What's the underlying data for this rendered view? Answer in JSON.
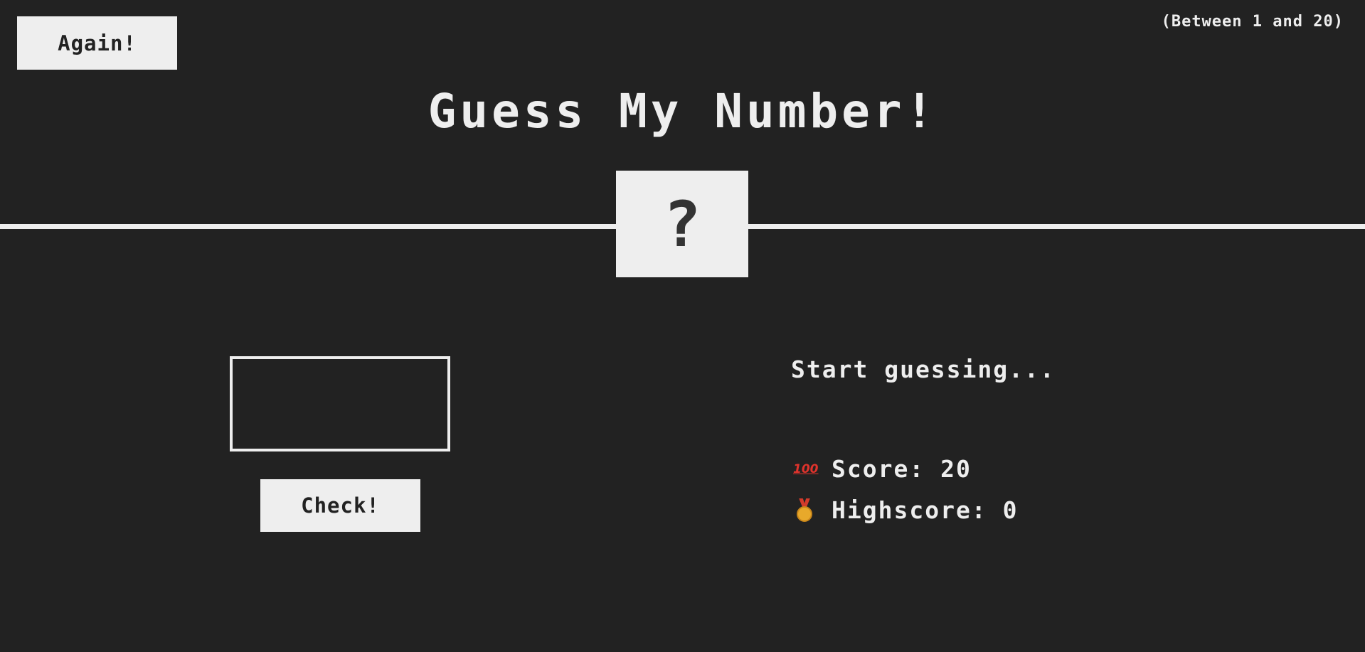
{
  "header": {
    "again_label": "Again!",
    "range_label": "(Between 1 and 20)",
    "title": "Guess My Number!"
  },
  "secret": {
    "display": "?"
  },
  "guess": {
    "value": "",
    "check_label": "Check!"
  },
  "status": {
    "message": "Start guessing...",
    "score_label": "Score:",
    "score_value": "20",
    "highscore_label": "Highscore:",
    "highscore_value": "0",
    "score_icon": "hundred-points-icon",
    "highscore_icon": "medal-icon"
  },
  "colors": {
    "background": "#222222",
    "foreground": "#eeeeee"
  }
}
